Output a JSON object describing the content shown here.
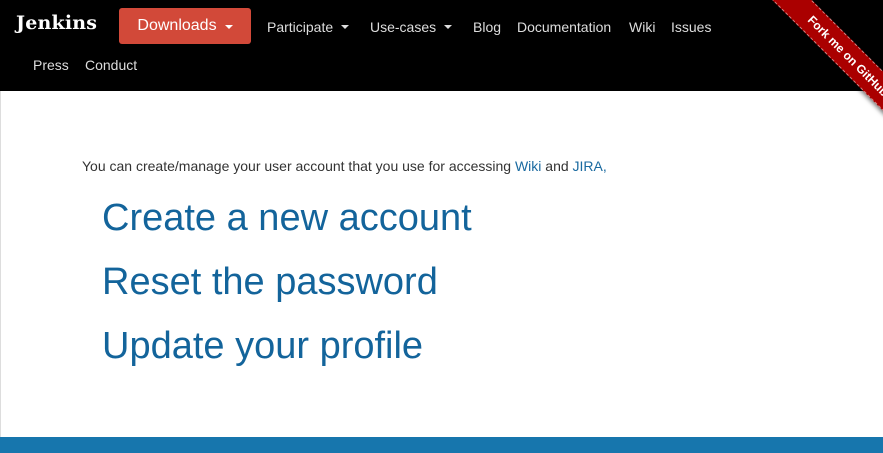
{
  "navbar": {
    "brand": "Jenkins",
    "downloads_label": "Downloads",
    "items_row1": [
      "Participate",
      "Use-cases",
      "Blog",
      "Documentation",
      "Wiki",
      "Issues"
    ],
    "items_row2": [
      "Press",
      "Conduct"
    ],
    "background_color": "#000000",
    "downloads_color": "#d24939"
  },
  "ribbon": {
    "label": "Fork me on GitHub",
    "color": "#aa0000"
  },
  "main": {
    "intro_text": "You can create/manage your user account that you use for accessing",
    "wiki_link": "Wiki",
    "and_text": "and",
    "jira_link": "JIRA",
    "trailing": ",",
    "links": [
      "Create a new account",
      "Reset the password",
      "Update your profile"
    ],
    "link_color": "#13649b"
  },
  "footer": {
    "color": "#1776ad"
  }
}
